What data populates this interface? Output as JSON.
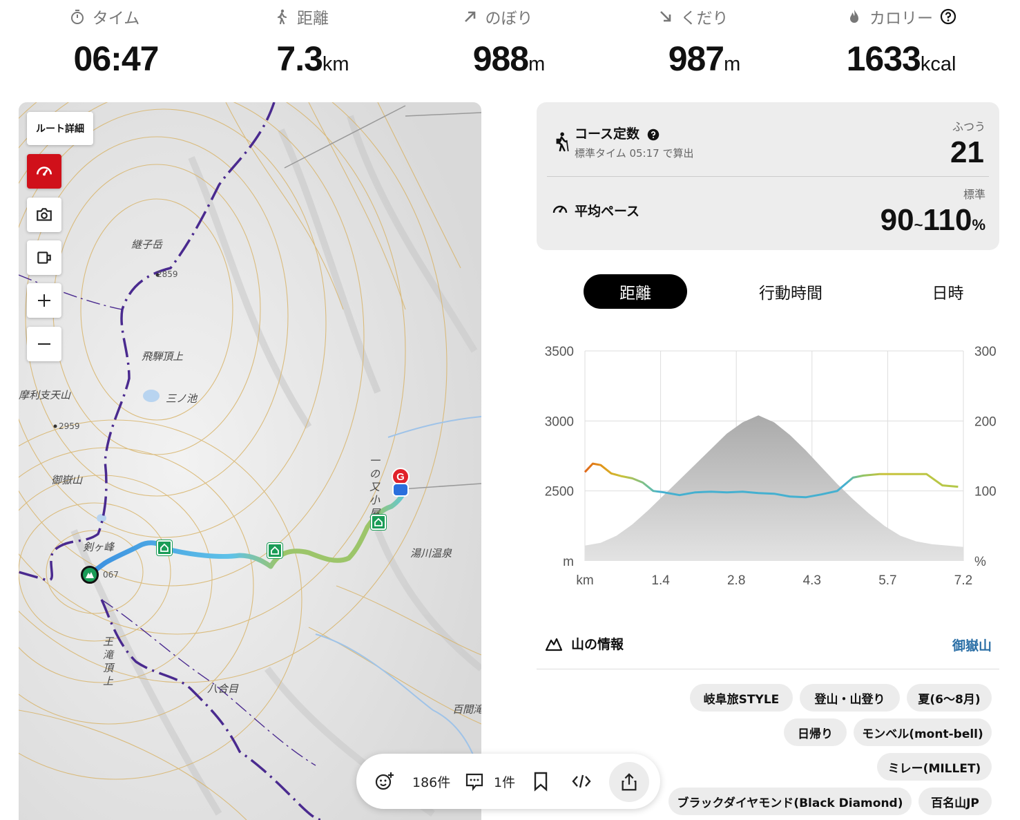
{
  "stats": [
    {
      "label": "タイム",
      "icon": "stopwatch-icon",
      "value": "06:47",
      "unit": ""
    },
    {
      "label": "距離",
      "icon": "walker-icon",
      "value": "7.3",
      "unit": "km"
    },
    {
      "label": "のぼり",
      "icon": "arrow-up-right-icon",
      "value": "988",
      "unit": "m"
    },
    {
      "label": "くだり",
      "icon": "arrow-down-right-icon",
      "value": "987",
      "unit": "m"
    },
    {
      "label": "カロリー",
      "icon": "flame-icon",
      "value": "1633",
      "unit": "kcal"
    }
  ],
  "map": {
    "route_detail_label": "ルート詳細",
    "labels": {
      "tsugiko": "継子岳",
      "elev2859": "2859",
      "hida": "飛騨頂上",
      "sannoike": "三ノ池",
      "marishiten": "摩利支天山",
      "elev2959": "2959",
      "ontakesan": "御嶽山",
      "kengamine": "剣ヶ峰",
      "elev067": "067",
      "ichinomata": "一の又小屋",
      "yukawa": "湯川温泉",
      "outaki": "王滝頂上",
      "hachigome": "八合目",
      "hyakuma": "百間滝",
      "goal": "G"
    }
  },
  "action_bar": {
    "likes": "186件",
    "comments": "1件"
  },
  "course_card": {
    "title": "コース定数",
    "subtitle": "標準タイム 05:17 で算出",
    "level_label": "ふつう",
    "value": "21",
    "pace_title": "平均ペース",
    "pace_level": "標準",
    "pace_low": "90",
    "pace_sep": "~",
    "pace_high": "110",
    "pace_unit": "%"
  },
  "tabs": [
    "距離",
    "行動時間",
    "日時"
  ],
  "active_tab": "距離",
  "chart_data": {
    "type": "area",
    "x_ticks": [
      "km",
      "1.4",
      "2.8",
      "4.3",
      "5.7",
      "7.2"
    ],
    "y_left_ticks": [
      "3500",
      "3000",
      "2500",
      "m"
    ],
    "y_right_ticks": [
      "300",
      "200",
      "100",
      "%"
    ],
    "ylim_left": [
      2000,
      3500
    ],
    "ylim_right": [
      0,
      300
    ],
    "xlim": [
      0,
      7.2
    ],
    "series": [
      {
        "axis": "left",
        "x": [
          0,
          0.3,
          0.6,
          0.9,
          1.2,
          1.5,
          1.8,
          2.1,
          2.4,
          2.7,
          3.0,
          3.3,
          3.6,
          3.9,
          4.2,
          4.5,
          4.8,
          5.1,
          5.4,
          5.7,
          6.0,
          6.3,
          6.6,
          6.9,
          7.2
        ],
        "y": [
          2110,
          2130,
          2180,
          2260,
          2360,
          2470,
          2580,
          2690,
          2800,
          2910,
          2990,
          3040,
          2990,
          2900,
          2790,
          2670,
          2550,
          2440,
          2340,
          2250,
          2180,
          2140,
          2120,
          2110,
          2100
        ]
      },
      {
        "axis": "right",
        "x": [
          0,
          0.15,
          0.3,
          0.5,
          0.7,
          0.9,
          1.1,
          1.3,
          1.5,
          1.8,
          2.1,
          2.4,
          2.7,
          3.0,
          3.3,
          3.6,
          3.9,
          4.2,
          4.5,
          4.8,
          5.1,
          5.3,
          5.6,
          5.9,
          6.2,
          6.5,
          6.8,
          7.1
        ],
        "y": [
          127,
          139,
          137,
          125,
          121,
          118,
          112,
          100,
          98,
          94,
          98,
          99,
          98,
          99,
          97,
          96,
          92,
          91,
          95,
          100,
          119,
          122,
          124,
          124,
          124,
          124,
          108,
          106
        ]
      }
    ]
  },
  "mountain_info": {
    "title": "山の情報",
    "link": "御嶽山"
  },
  "tags": [
    "岐阜旅STYLE",
    "登山・山登り",
    "夏(6〜8月)",
    "日帰り",
    "モンベル(mont-bell)",
    "ミレー(MILLET)",
    "ブラックダイヤモンド(Black Diamond)",
    "百名山JP"
  ]
}
